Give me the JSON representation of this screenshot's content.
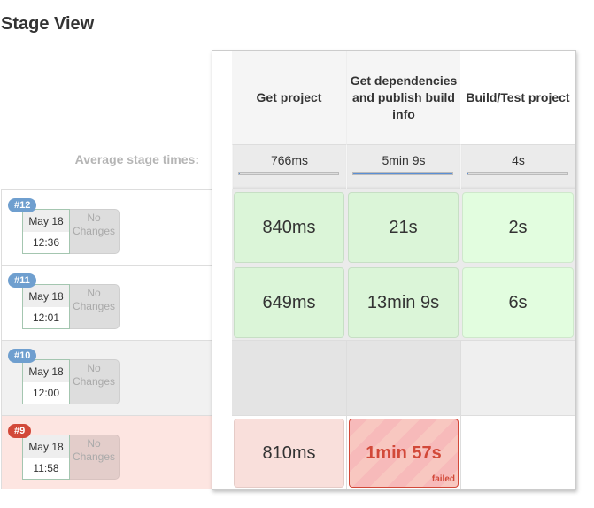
{
  "page": {
    "title": "Stage View"
  },
  "average_label": "Average stage times:",
  "stages": [
    {
      "name": "Get project",
      "average": "766ms",
      "avg_fraction": 0.003
    },
    {
      "name": "Get dependencies and publish build info",
      "average": "5min 9s",
      "avg_fraction": 1.0
    },
    {
      "name": "Build/Test project",
      "average": "4s",
      "avg_fraction": 0.013
    }
  ],
  "builds": [
    {
      "number": "#12",
      "badge_color": "#6f9fcf",
      "date": "May 18",
      "time": "12:36",
      "changes": "No Changes",
      "status": "success",
      "stages": [
        {
          "duration": "840ms",
          "status": "success"
        },
        {
          "duration": "21s",
          "status": "success"
        },
        {
          "duration": "2s",
          "status": "success"
        }
      ]
    },
    {
      "number": "#11",
      "badge_color": "#6f9fcf",
      "date": "May 18",
      "time": "12:01",
      "changes": "No Changes",
      "status": "success",
      "stages": [
        {
          "duration": "649ms",
          "status": "success"
        },
        {
          "duration": "13min 9s",
          "status": "success"
        },
        {
          "duration": "6s",
          "status": "success"
        }
      ]
    },
    {
      "number": "#10",
      "badge_color": "#6f9fcf",
      "date": "May 18",
      "time": "12:00",
      "changes": "No Changes",
      "status": "aborted",
      "stages": [
        {
          "duration": "",
          "status": "empty"
        },
        {
          "duration": "",
          "status": "empty"
        },
        {
          "duration": "",
          "status": "empty"
        }
      ]
    },
    {
      "number": "#9",
      "badge_color": "#d24939",
      "date": "May 18",
      "time": "11:58",
      "changes": "No Changes",
      "status": "failed",
      "stages": [
        {
          "duration": "810ms",
          "status": "success-in-failed-build"
        },
        {
          "duration": "1min 57s",
          "status": "failed",
          "label": "failed"
        },
        {
          "duration": "",
          "status": "not-run"
        }
      ]
    }
  ],
  "colors": {
    "success_bg": "#dbf5d8",
    "failed": "#d24939",
    "failed_row_bg": "#fde5e1",
    "bar_fill": "#5a8fd6"
  }
}
